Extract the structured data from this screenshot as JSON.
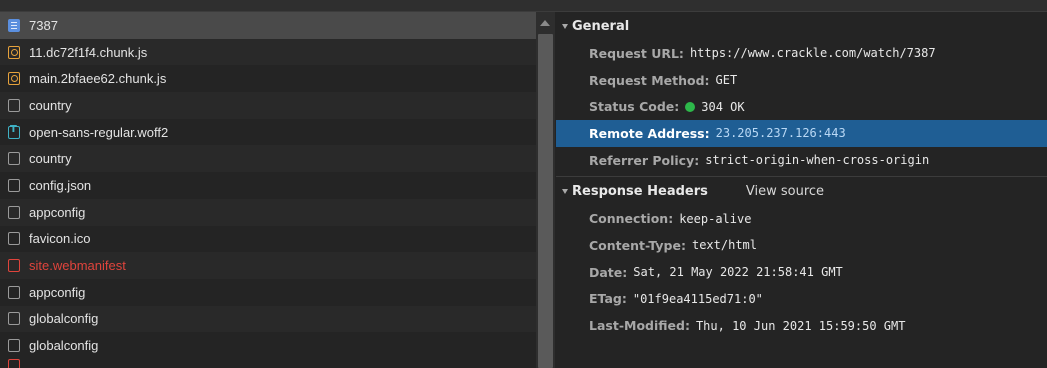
{
  "requests": [
    {
      "name": "7387",
      "icon": "document-icon",
      "kind": "doc",
      "selected": true
    },
    {
      "name": "11.dc72f1f4.chunk.js",
      "icon": "script-icon",
      "kind": "script"
    },
    {
      "name": "main.2bfaee62.chunk.js",
      "icon": "script-icon",
      "kind": "script"
    },
    {
      "name": "country",
      "icon": "file-icon",
      "kind": "plain"
    },
    {
      "name": "open-sans-regular.woff2",
      "icon": "font-icon",
      "kind": "font"
    },
    {
      "name": "country",
      "icon": "file-icon",
      "kind": "plain"
    },
    {
      "name": "config.json",
      "icon": "file-icon",
      "kind": "plain"
    },
    {
      "name": "appconfig",
      "icon": "file-icon",
      "kind": "plain"
    },
    {
      "name": "favicon.ico",
      "icon": "file-icon",
      "kind": "plain"
    },
    {
      "name": "site.webmanifest",
      "icon": "error-file-icon",
      "kind": "error"
    },
    {
      "name": "appconfig",
      "icon": "file-icon",
      "kind": "plain"
    },
    {
      "name": "globalconfig",
      "icon": "file-icon",
      "kind": "plain"
    },
    {
      "name": "globalconfig",
      "icon": "file-icon",
      "kind": "plain"
    }
  ],
  "general": {
    "title": "General",
    "rows": [
      {
        "key": "Request URL:",
        "value": "https://www.crackle.com/watch/7387"
      },
      {
        "key": "Request Method:",
        "value": "GET"
      },
      {
        "key": "Status Code:",
        "value": "304 OK",
        "status_color": "#2db84a"
      },
      {
        "key": "Remote Address:",
        "value": "23.205.237.126:443",
        "highlighted": true
      },
      {
        "key": "Referrer Policy:",
        "value": "strict-origin-when-cross-origin"
      }
    ]
  },
  "response_headers": {
    "title": "Response Headers",
    "view_source": "View source",
    "rows": [
      {
        "key": "Connection:",
        "value": "keep-alive"
      },
      {
        "key": "Content-Type:",
        "value": "text/html"
      },
      {
        "key": "Date:",
        "value": "Sat, 21 May 2022 21:58:41 GMT"
      },
      {
        "key": "ETag:",
        "value": "\"01f9ea4115ed71:0\""
      },
      {
        "key": "Last-Modified:",
        "value": "Thu, 10 Jun 2021 15:59:50 GMT"
      }
    ]
  },
  "colors": {
    "highlight": "#1f5e94",
    "error": "#e0443c",
    "selected_row": "#4a4a4a"
  }
}
